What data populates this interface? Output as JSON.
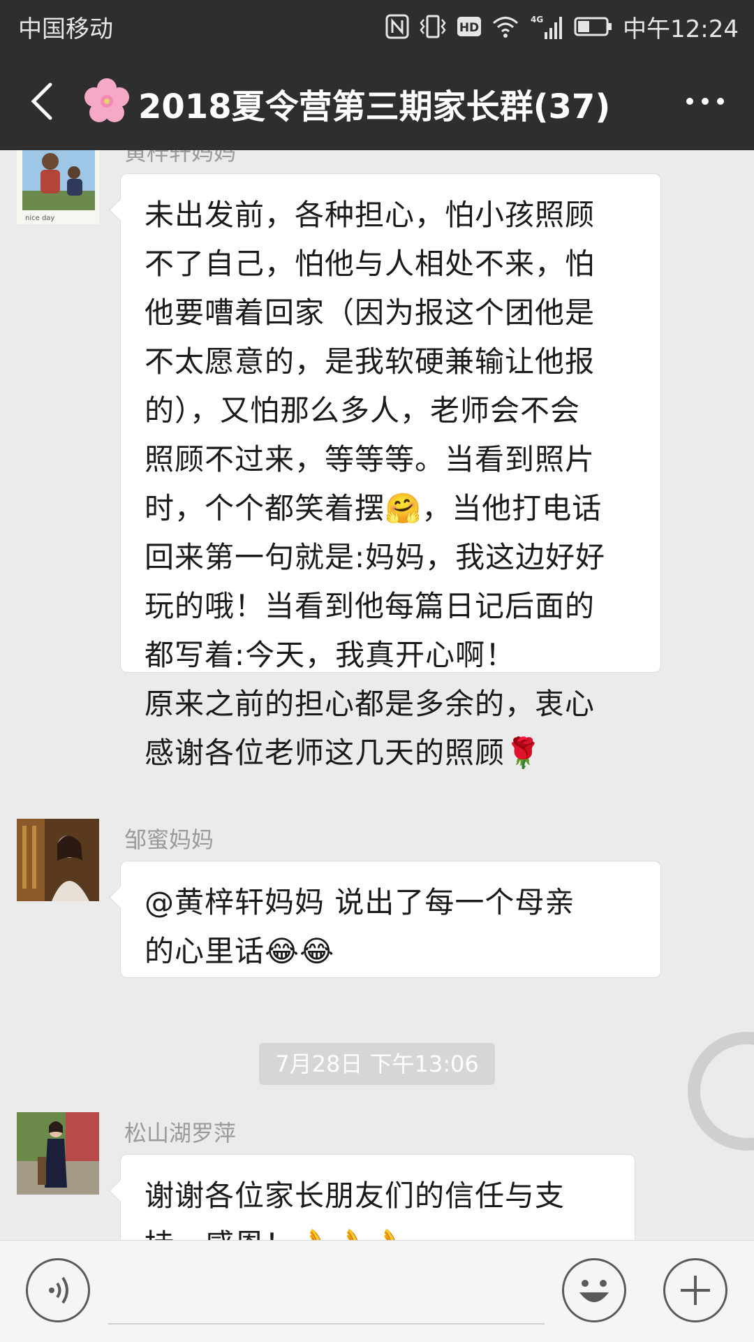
{
  "status_bar": {
    "carrier": "中国移动",
    "time": "中午12:24",
    "icons": [
      "nfc-icon",
      "vibrate-icon",
      "hd-icon",
      "wifi-icon",
      "4g-signal-icon",
      "battery-icon"
    ]
  },
  "title_bar": {
    "title": "2018夏令营第三期家长群(37)",
    "back_icon": "back-arrow-icon",
    "group_icon": "cherry-blossom-icon",
    "more_icon": "more-dots-icon"
  },
  "messages": [
    {
      "sender": "黄梓轩妈妈",
      "lines": [
        "未出发前，各种担心，怕小孩照顾",
        "不了自己，怕他与人相处不来，怕",
        "他要嘈着回家（因为报这个团他是",
        "不太愿意的，是我软硬兼输让他报",
        "的），又怕那么多人，老师会不会",
        "照顾不过来，等等等。当看到照片",
        "时，个个都笑着摆🤗，当他打电话",
        "回来第一句就是:妈妈，我这边好好",
        "玩的哦！当看到他每篇日记后面的",
        "都写着:今天，我真开心啊！",
        "原来之前的担心都是多余的，衷心",
        "感谢各位老师这几天的照顾🌹"
      ]
    },
    {
      "sender": "邹蜜妈妈",
      "lines": [
        "@黄梓轩妈妈  说出了每一个母亲",
        "的心里话😂😂"
      ]
    },
    {
      "timestamp": "7月28日 下午13:06"
    },
    {
      "sender": "松山湖罗萍",
      "lines": [
        "谢谢各位家长朋友们的信任与支",
        "持，感恩！👌👌👌"
      ]
    }
  ],
  "input_bar": {
    "voice_icon": "voice-icon",
    "emoji_icon": "emoji-icon",
    "plus_icon": "plus-icon",
    "input_value": ""
  }
}
